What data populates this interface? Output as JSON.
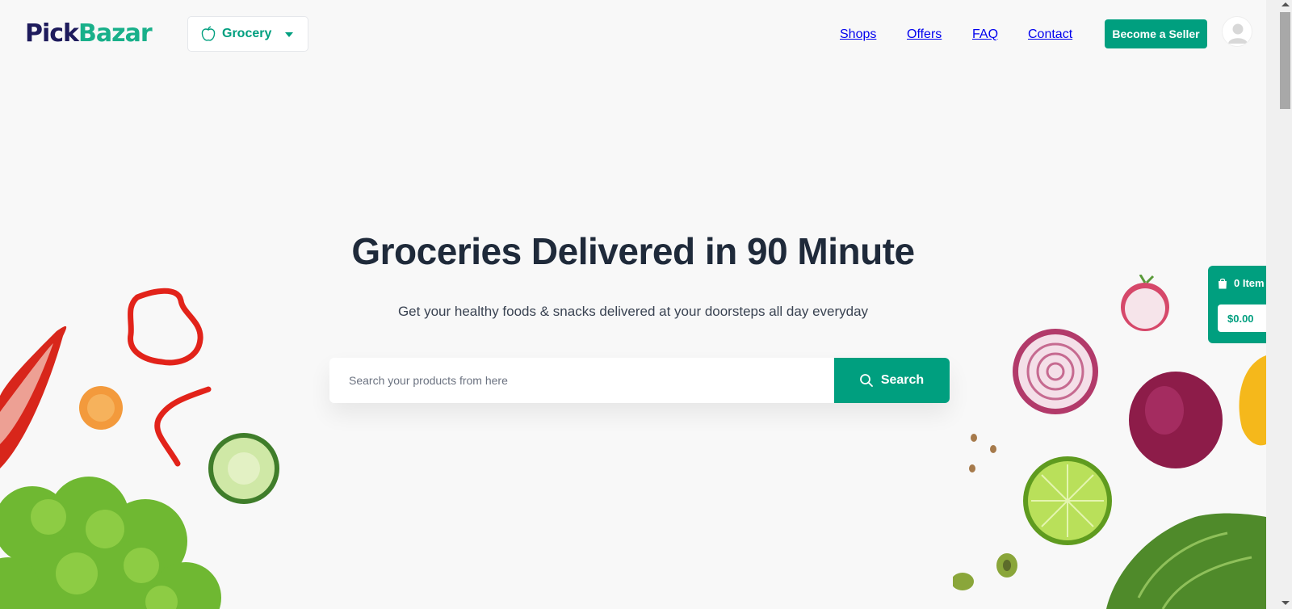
{
  "header": {
    "logo": {
      "part1": "Pick",
      "part2": "Bazar"
    },
    "type_select": {
      "value": "Grocery",
      "icon": "apple-icon"
    },
    "nav": [
      {
        "label": "Shops"
      },
      {
        "label": "Offers"
      },
      {
        "label": "FAQ"
      },
      {
        "label": "Contact"
      }
    ],
    "seller_button": "Become a Seller",
    "avatar_icon": "user-avatar-icon"
  },
  "hero": {
    "title": "Groceries Delivered in 90 Minute",
    "subtitle": "Get your healthy foods & snacks delivered at your doorsteps all day everyday",
    "search_placeholder": "Search your products from here",
    "search_button": "Search",
    "search_icon": "search-icon"
  },
  "cart": {
    "items_label": "0 Item",
    "total": "$0.00",
    "icon": "shopping-bag-icon"
  },
  "colors": {
    "accent": "#009f7f",
    "logo_dark": "#1e1b5c",
    "logo_green": "#19b08a",
    "background": "#f8f8f8",
    "heading": "#1f2a3a"
  }
}
